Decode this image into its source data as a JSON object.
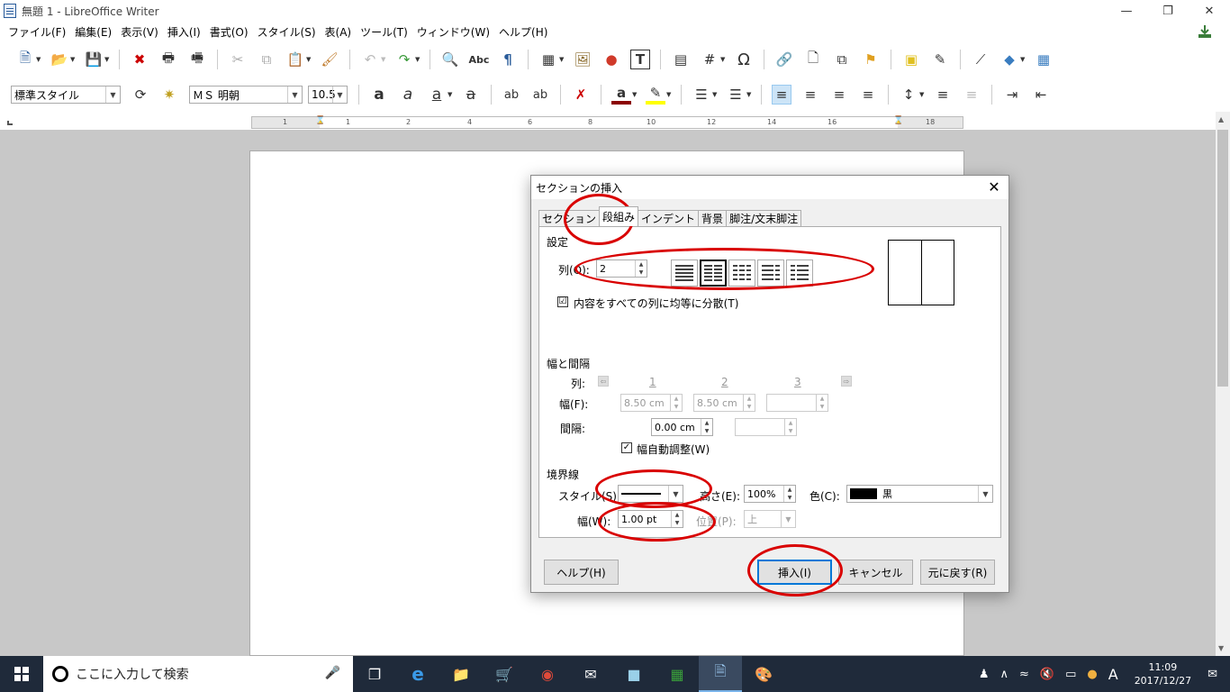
{
  "window": {
    "title": "無題 1 - LibreOffice Writer"
  },
  "menu": [
    "ファイル(F)",
    "編集(E)",
    "表示(V)",
    "挿入(I)",
    "書式(O)",
    "スタイル(S)",
    "表(A)",
    "ツール(T)",
    "ウィンドウ(W)",
    "ヘルプ(H)"
  ],
  "format_bar": {
    "paragraph_style": "標準スタイル",
    "font_name": "ＭＳ 明朝",
    "font_size": "10.5"
  },
  "ruler": {
    "numbers": [
      "1",
      "1",
      "2",
      "4",
      "6",
      "8",
      "10",
      "12",
      "14",
      "16",
      "18"
    ]
  },
  "dialog": {
    "title": "セクションの挿入",
    "tabs": [
      "セクション",
      "段組み",
      "インデント",
      "背景",
      "脚注/文末脚注"
    ],
    "settings": {
      "group": "設定",
      "columns_label": "列(O):",
      "columns_value": "2",
      "even_distribute_label": "内容をすべての列に均等に分散(T)",
      "even_distribute_checked": "☑"
    },
    "width_spacing": {
      "group": "幅と間隔",
      "column_label": "列:",
      "col_numbers": [
        "1",
        "2",
        "3"
      ],
      "width_label": "幅(F):",
      "width_values": [
        "8.50 cm",
        "8.50 cm",
        ""
      ],
      "spacing_label": "間隔:",
      "spacing_value": "0.00 cm",
      "autowidth_label": "幅自動調整(W)"
    },
    "separator": {
      "group": "境界線",
      "style_label": "スタイル(S):",
      "height_label": "高さ(E):",
      "height_value": "100%",
      "color_label": "色(C):",
      "color_value": "黒",
      "width_label": "幅(W):",
      "width_value": "1.00 pt",
      "position_label": "位置(P):",
      "position_value": "上"
    },
    "buttons": {
      "help": "ヘルプ(H)",
      "insert": "挿入(I)",
      "cancel": "キャンセル",
      "reset": "元に戻す(R)"
    }
  },
  "taskbar": {
    "search_placeholder": "ここに入力して検索",
    "time": "11:09",
    "date": "2017/12/27",
    "ime": "A"
  },
  "colors": {
    "annotation": "#d90000",
    "taskbar": "#1f2a3a",
    "accent": "#0078d7"
  }
}
